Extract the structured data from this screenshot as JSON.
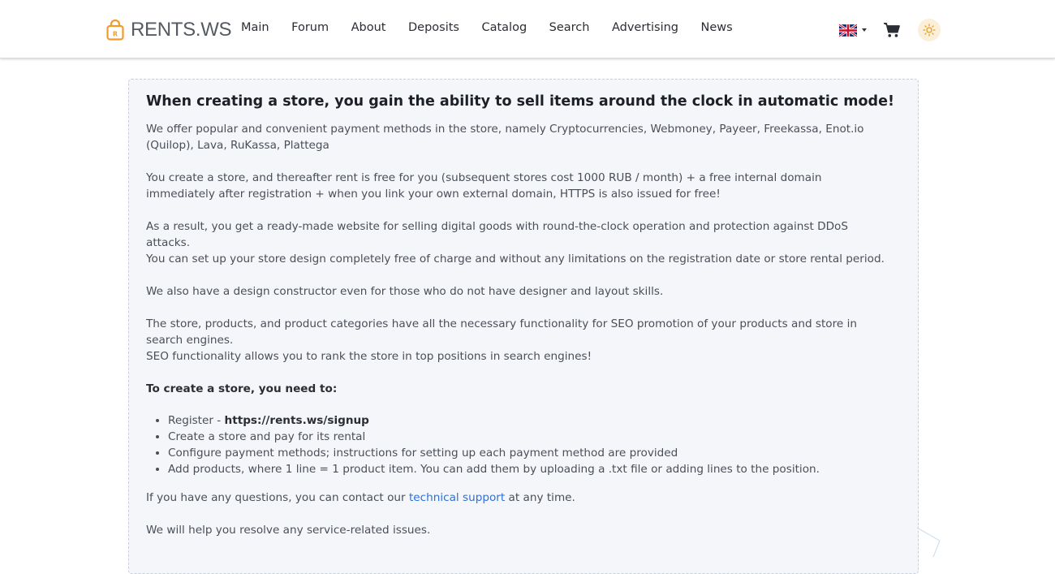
{
  "brand": {
    "name": "RENTS.WS"
  },
  "nav": [
    {
      "label": "Main"
    },
    {
      "label": "Forum"
    },
    {
      "label": "About"
    },
    {
      "label": "Deposits"
    },
    {
      "label": "Catalog"
    },
    {
      "label": "Search"
    },
    {
      "label": "Advertising"
    },
    {
      "label": "News"
    }
  ],
  "header_icons": {
    "language": "uk-flag-icon",
    "cart": "cart-icon",
    "theme": "sun-icon"
  },
  "colors": {
    "accent_orange": "#f39a2c",
    "link_blue": "#2f6fd6",
    "card_bg": "#f4f6fa"
  },
  "content": {
    "heading": "When creating a store, you gain the ability to sell items around the clock in automatic mode!",
    "paragraphs": [
      "We offer popular and convenient payment methods in the store, namely  Cryptocurrencies, Webmoney, Payeer, Freekassa, Enot.io (Quilop), Lava, RuKassa, Plattega",
      "You create a store, and thereafter rent is free for you (subsequent stores cost 1000 RUB / month) + a free internal domain immediately after registration + when you link your own external domain, HTTPS is also issued for free!",
      "As a result, you get a ready-made website for selling digital goods with round-the-clock operation and protection against DDoS attacks.",
      "You can set up your store design completely free of charge and without any limitations on the registration date or store rental period.",
      "We also have a design constructor even for those who do not have designer and layout skills.",
      "The store, products, and product categories have all the necessary functionality for SEO promotion of your products and store in search engines.",
      "SEO functionality allows you to rank the store in top positions in search engines!"
    ],
    "steps_title": "To create a store, you need to:",
    "steps": {
      "register_prefix": "Register - ",
      "register_url": "https://rents.ws/signup",
      "step2": "Create a store and pay for its rental",
      "step3": "Configure payment methods; instructions for setting up each payment method are provided",
      "step4": "Add products, where 1 line = 1 product item. You can add them by uploading a .txt file or adding lines to the position."
    },
    "questions": {
      "before": "If you have any questions, you can contact our ",
      "link": "technical support",
      "after": " at any time."
    },
    "closing": "We will help you resolve any service-related issues."
  }
}
